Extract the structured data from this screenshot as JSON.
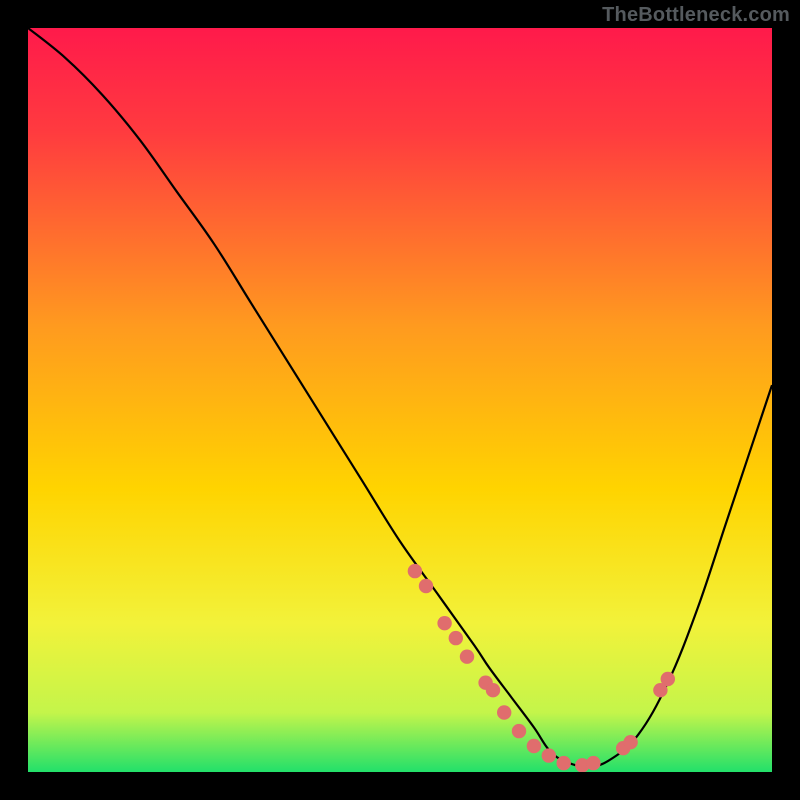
{
  "watermark": "TheBottleneck.com",
  "chart_data": {
    "type": "line",
    "title": "",
    "xlabel": "",
    "ylabel": "",
    "xlim": [
      0,
      100
    ],
    "ylim": [
      0,
      100
    ],
    "grid": false,
    "legend": false,
    "background_gradient": [
      "#ff1a4b",
      "#ffd400",
      "#22e06a"
    ],
    "series": [
      {
        "name": "bottleneck-curve",
        "x": [
          0,
          5,
          10,
          15,
          20,
          25,
          30,
          35,
          40,
          45,
          50,
          55,
          60,
          62,
          65,
          68,
          70,
          72,
          75,
          78,
          82,
          86,
          90,
          94,
          98,
          100
        ],
        "y": [
          100,
          96,
          91,
          85,
          78,
          71,
          63,
          55,
          47,
          39,
          31,
          24,
          17,
          14,
          10,
          6,
          3,
          1.5,
          0.7,
          1.5,
          5,
          12,
          22,
          34,
          46,
          52
        ]
      }
    ],
    "highlight_points": {
      "name": "dots",
      "x": [
        52,
        53.5,
        56,
        57.5,
        59,
        61.5,
        62.5,
        64,
        66,
        68,
        70,
        72,
        74.5,
        76,
        80,
        81,
        85,
        86
      ],
      "y": [
        27,
        25,
        20,
        18,
        15.5,
        12,
        11,
        8,
        5.5,
        3.5,
        2.2,
        1.2,
        0.9,
        1.2,
        3.2,
        4,
        11,
        12.5
      ]
    }
  }
}
